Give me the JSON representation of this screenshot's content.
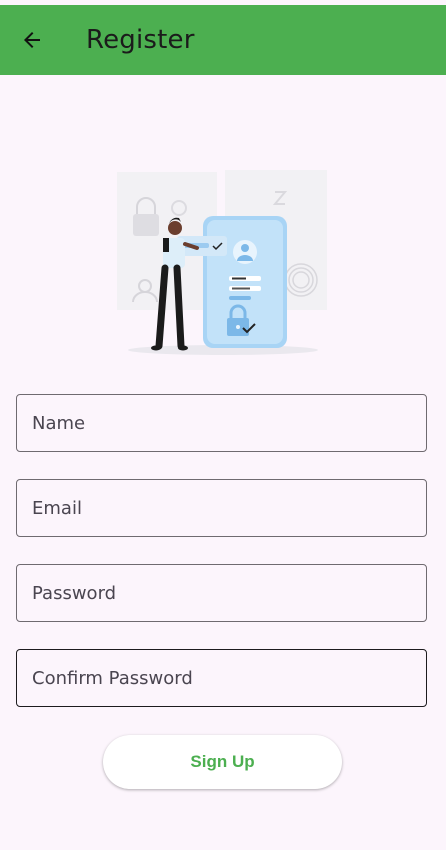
{
  "app_bar": {
    "title": "Register",
    "back_icon": "arrow-back-icon",
    "color": "#4CAF50"
  },
  "illustration": {
    "name": "login-security-illustration"
  },
  "form": {
    "name_placeholder": "Name",
    "email_placeholder": "Email",
    "password_placeholder": "Password",
    "confirm_password_placeholder": "Confirm Password"
  },
  "signup_button": {
    "label": "Sign Up"
  },
  "colors": {
    "background": "#FCF5FC",
    "accent": "#4CAF50",
    "phone": "#A8D4F5"
  }
}
